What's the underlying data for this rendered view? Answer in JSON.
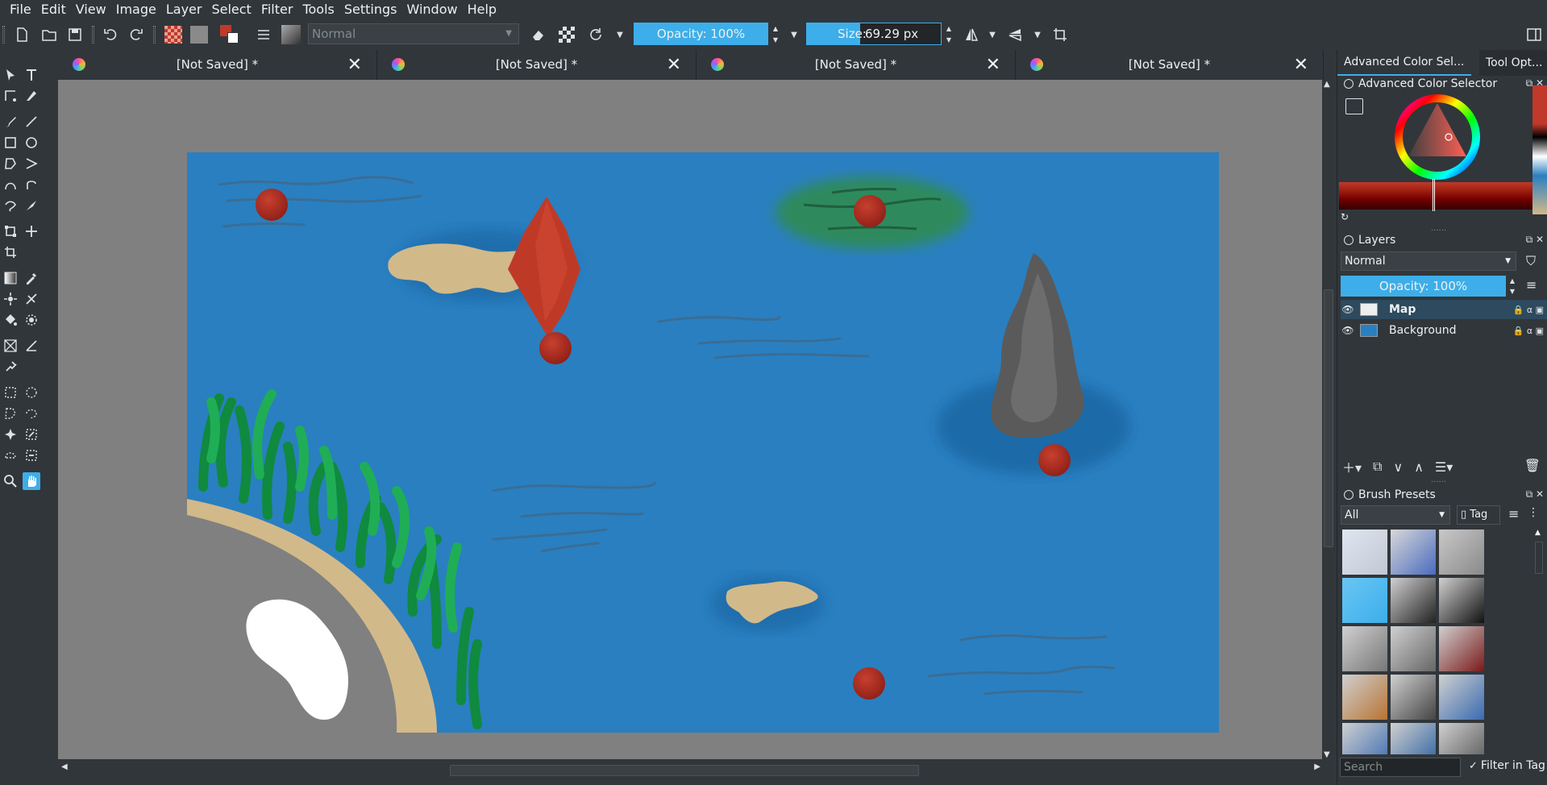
{
  "menu": [
    "File",
    "Edit",
    "View",
    "Image",
    "Layer",
    "Select",
    "Filter",
    "Tools",
    "Settings",
    "Window",
    "Help"
  ],
  "toolbar": {
    "blend_mode": "Normal",
    "opacity_label": "Opacity: 100%",
    "opacity_value": 100,
    "size_label": "Size:",
    "size_value": "69.29 px"
  },
  "tabs": [
    {
      "title": "[Not Saved]  *",
      "close": "✕"
    },
    {
      "title": "[Not Saved]  *",
      "close": "✕"
    },
    {
      "title": "[Not Saved]  *",
      "close": "✕"
    },
    {
      "title": "[Not Saved]  *",
      "close": "✕"
    }
  ],
  "dock": {
    "tabs": [
      "Advanced Color Sel...",
      "Tool Opt..."
    ],
    "color_selector_title": "Advanced Color Selector",
    "layers_title": "Layers",
    "layers_blend": "Normal",
    "layers_opacity": "Opacity:  100%",
    "layers": [
      {
        "name": "Map",
        "selected": true
      },
      {
        "name": "Background",
        "selected": false
      }
    ],
    "brush_presets_title": "Brush Presets",
    "brush_filter": "All",
    "tag_label": "Tag",
    "search_placeholder": "Search",
    "filter_in_tag": "Filter in Tag"
  },
  "colors": {
    "accent": "#3daee9",
    "foreground": "#c0392b",
    "background": "#ffffff",
    "water": "#2a7fc0",
    "sand": "#d2b98a",
    "rock": "#5a5a5a",
    "grass": "#1e9c4a",
    "marker": "#b0281d"
  }
}
